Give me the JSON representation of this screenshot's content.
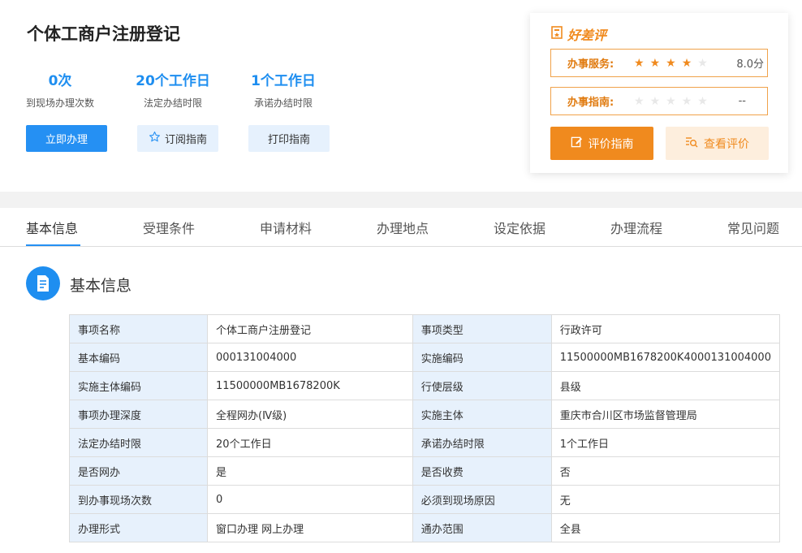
{
  "page": {
    "title": "个体工商户注册登记"
  },
  "stats": [
    {
      "value": "0次",
      "label": "到现场办理次数"
    },
    {
      "value": "20个工作日",
      "label": "法定办结时限"
    },
    {
      "value": "1个工作日",
      "label": "承诺办结时限"
    }
  ],
  "actions": {
    "handle": "立即办理",
    "subscribe": "订阅指南",
    "print": "打印指南"
  },
  "rating": {
    "title": "好差评",
    "service_label": "办事服务:",
    "service_stars": 4,
    "service_score": "8.0分",
    "guide_label": "办事指南:",
    "guide_stars": 0,
    "guide_score": "--",
    "evaluate_button": "评价指南",
    "view_button": "查看评价",
    "accent_color": "#f08a1e"
  },
  "tabs": [
    "基本信息",
    "受理条件",
    "申请材料",
    "办理地点",
    "设定依据",
    "办理流程",
    "常见问题"
  ],
  "section": {
    "title": "基本信息",
    "icon": "document-icon"
  },
  "info_table": [
    [
      "事项名称",
      "个体工商户注册登记",
      "事项类型",
      "行政许可"
    ],
    [
      "基本编码",
      "000131004000",
      "实施编码",
      "11500000MB1678200K4000131004000"
    ],
    [
      "实施主体编码",
      "11500000MB1678200K",
      "行使层级",
      "县级"
    ],
    [
      "事项办理深度",
      "全程网办(Ⅳ级)",
      "实施主体",
      "重庆市合川区市场监督管理局"
    ],
    [
      "法定办结时限",
      "20个工作日",
      "承诺办结时限",
      "1个工作日"
    ],
    [
      "是否网办",
      "是",
      "是否收费",
      "否"
    ],
    [
      "到办事现场次数",
      "0",
      "必须到现场原因",
      "无"
    ],
    [
      "办理形式",
      "窗口办理 网上办理",
      "通办范围",
      "全县"
    ]
  ],
  "colors": {
    "primary": "#2590f3",
    "light_blue": "#e6f1fd",
    "orange": "#f08a1e"
  }
}
